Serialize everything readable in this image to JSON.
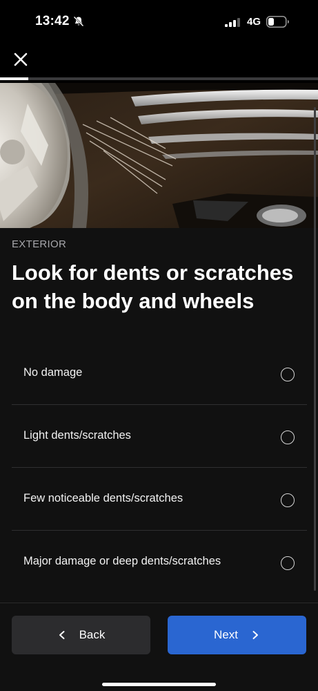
{
  "status_bar": {
    "time": "13:42",
    "network": "4G",
    "icons": [
      "bell-slash-icon",
      "signal-icon",
      "battery-icon"
    ]
  },
  "header": {
    "close_icon": "close-icon",
    "progress_fraction": 0.09
  },
  "hero": {
    "image": "car-body-scratches-photo"
  },
  "inspection": {
    "category": "EXTERIOR",
    "question": "Look for dents or scratches on the body and wheels",
    "options": [
      {
        "label": "No damage",
        "selected": false
      },
      {
        "label": "Light dents/scratches",
        "selected": false
      },
      {
        "label": "Few noticeable dents/scratches",
        "selected": false
      },
      {
        "label": "Major damage or deep dents/scratches",
        "selected": false
      }
    ]
  },
  "footer": {
    "back_label": "Back",
    "next_label": "Next",
    "next_color": "#2a66d1",
    "back_color": "#2c2c2e"
  }
}
